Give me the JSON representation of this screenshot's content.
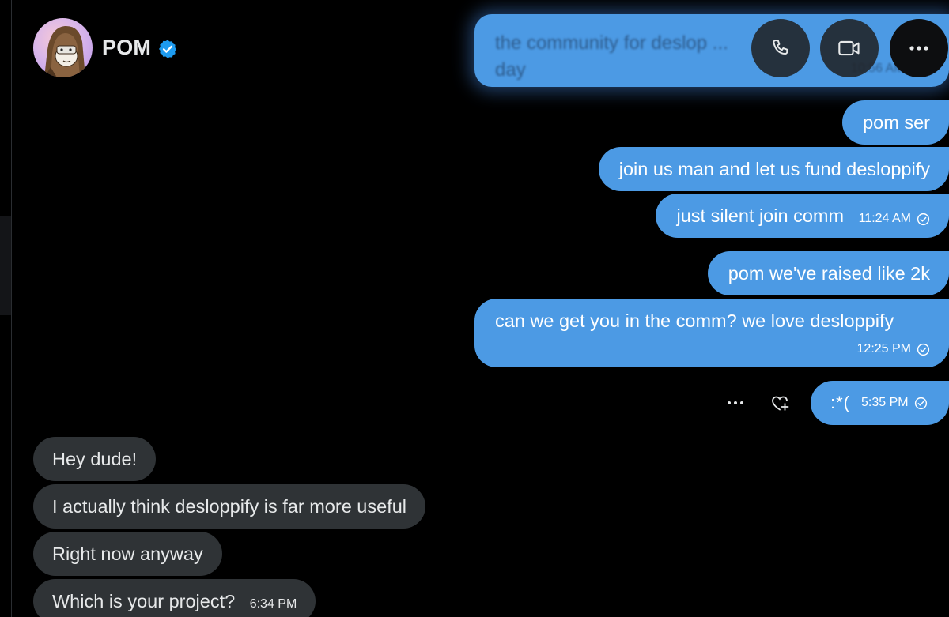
{
  "header": {
    "name": "POM",
    "avatar_icon": "cartoon-avatar",
    "verified_icon": "verified-badge-icon",
    "verified_color": "#1d9bf0",
    "buttons": [
      "phone-icon",
      "video-icon",
      "more-icon"
    ]
  },
  "colors": {
    "outgoing_bubble": "#4c9ae4",
    "incoming_bubble": "#2f3336",
    "background": "#000000"
  },
  "blurred_message": {
    "text_line1": "the community for deslop ...",
    "text_line2": "day",
    "time": "10:56 AM"
  },
  "outgoing": [
    {
      "text": "pom ser"
    },
    {
      "text": "join us man and let us fund desloppify"
    },
    {
      "text": "just silent join comm",
      "time": "11:24 AM",
      "status_icon": "sent-check-icon"
    },
    {
      "text": "pom we've raised like 2k"
    },
    {
      "text": "can we get you in the comm? we love desloppify",
      "time": "12:25 PM",
      "status_icon": "sent-check-icon"
    },
    {
      "text": ":*(",
      "time": "5:35 PM",
      "status_icon": "sent-check-icon"
    }
  ],
  "message_actions": [
    "more-dots-icon",
    "add-reaction-icon"
  ],
  "incoming": [
    {
      "text": "Hey dude!"
    },
    {
      "text": "I actually think desloppify is far more useful"
    },
    {
      "text": "Right now anyway"
    },
    {
      "text": "Which is your project?",
      "time": "6:34 PM"
    }
  ]
}
